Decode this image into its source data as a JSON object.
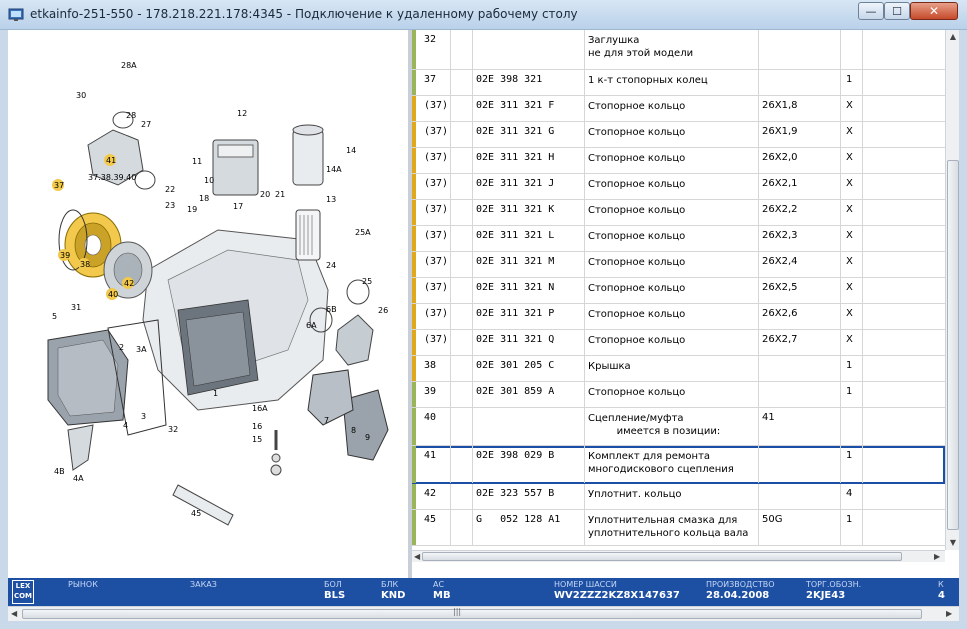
{
  "window": {
    "title": "etkainfo-251-550 - 178.218.221.178:4345 - Подключение к удаленному рабочему столу",
    "min_label": "—",
    "max_label": "☐",
    "close_label": "✕"
  },
  "diagram": {
    "labels": [
      "28A",
      "30",
      "28",
      "27",
      "12",
      "11",
      "14",
      "14A",
      "10",
      "13",
      "41",
      "37.38.39.40",
      "37",
      "22",
      "23",
      "18",
      "19",
      "17",
      "20",
      "21",
      "25A",
      "39",
      "38",
      "40",
      "42",
      "24",
      "25",
      "31",
      "6A",
      "6B",
      "26",
      "5",
      "2",
      "3A",
      "3",
      "7",
      "16A",
      "16",
      "15",
      "1",
      "4",
      "8",
      "9",
      "32",
      "4B",
      "4A",
      "45"
    ]
  },
  "parts": [
    {
      "pos": "32",
      "part": "",
      "name": "Заглушка\nне для этой модели",
      "note": "",
      "qty": "",
      "color": "#9ab45a"
    },
    {
      "pos": "37",
      "part": "02E 398 321",
      "name": "1 к-т стопорных колец",
      "note": "",
      "qty": "1",
      "color": "#9ab45a"
    },
    {
      "pos": "(37)",
      "part": "02E 311 321 F",
      "name": "Стопорное кольцо",
      "note": "26X1,8",
      "qty": "X",
      "color": "#e0a81c"
    },
    {
      "pos": "(37)",
      "part": "02E 311 321 G",
      "name": "Стопорное кольцо",
      "note": "26X1,9",
      "qty": "X",
      "color": "#e0a81c"
    },
    {
      "pos": "(37)",
      "part": "02E 311 321 H",
      "name": "Стопорное кольцо",
      "note": "26X2,0",
      "qty": "X",
      "color": "#e0a81c"
    },
    {
      "pos": "(37)",
      "part": "02E 311 321 J",
      "name": "Стопорное кольцо",
      "note": "26X2,1",
      "qty": "X",
      "color": "#e0a81c"
    },
    {
      "pos": "(37)",
      "part": "02E 311 321 K",
      "name": "Стопорное кольцо",
      "note": "26X2,2",
      "qty": "X",
      "color": "#e0a81c"
    },
    {
      "pos": "(37)",
      "part": "02E 311 321 L",
      "name": "Стопорное кольцо",
      "note": "26X2,3",
      "qty": "X",
      "color": "#e0a81c"
    },
    {
      "pos": "(37)",
      "part": "02E 311 321 M",
      "name": "Стопорное кольцо",
      "note": "26X2,4",
      "qty": "X",
      "color": "#e0a81c"
    },
    {
      "pos": "(37)",
      "part": "02E 311 321 N",
      "name": "Стопорное кольцо",
      "note": "26X2,5",
      "qty": "X",
      "color": "#e0a81c"
    },
    {
      "pos": "(37)",
      "part": "02E 311 321 P",
      "name": "Стопорное кольцо",
      "note": "26X2,6",
      "qty": "X",
      "color": "#e0a81c"
    },
    {
      "pos": "(37)",
      "part": "02E 311 321 Q",
      "name": "Стопорное кольцо",
      "note": "26X2,7",
      "qty": "X",
      "color": "#e0a81c"
    },
    {
      "pos": "38",
      "part": "02E 301 205 C",
      "name": "Крышка",
      "note": "",
      "qty": "1",
      "color": "#e0a81c"
    },
    {
      "pos": "39",
      "part": "02E 301 859 A",
      "name": "Стопорное кольцо",
      "note": "",
      "qty": "1",
      "color": "#9ab45a"
    },
    {
      "pos": "40",
      "part": "",
      "name": "Сцепление/муфта\n         имеется в позиции:",
      "note": "41",
      "qty": "",
      "color": "#9ab45a"
    },
    {
      "pos": "41",
      "part": "02E 398 029 B",
      "name": "Комплект для ремонта\nмногодискового сцепления",
      "note": "",
      "qty": "1",
      "color": "#9ab45a"
    },
    {
      "pos": "42",
      "part": "02E 323 557 B",
      "name": "Уплотнит. кольцо",
      "note": "",
      "qty": "4",
      "color": "#9ab45a"
    },
    {
      "pos": "45",
      "part": "G   052 128 A1",
      "name": "Уплотнительная смазка для\nуплотнительного кольца вала",
      "note": "50G",
      "qty": "1",
      "color": "#9ab45a"
    }
  ],
  "status": {
    "logo": "LEX\nCOM",
    "fields": [
      {
        "label": "РЫНОК",
        "value": ""
      },
      {
        "label": "ЗАКАЗ",
        "value": ""
      },
      {
        "label": "БОЛ",
        "value": "BLS"
      },
      {
        "label": "БЛК",
        "value": "KND"
      },
      {
        "label": "АС",
        "value": "MB"
      },
      {
        "label": "НОМЕР ШАССИ",
        "value": "WV2ZZZ2KZ8X147637"
      },
      {
        "label": "ПРОИЗВОДСТВО",
        "value": "28.04.2008"
      },
      {
        "label": "ТОРГ.ОБОЗН.",
        "value": "2KJE43"
      },
      {
        "label": "К",
        "value": "4"
      }
    ]
  }
}
